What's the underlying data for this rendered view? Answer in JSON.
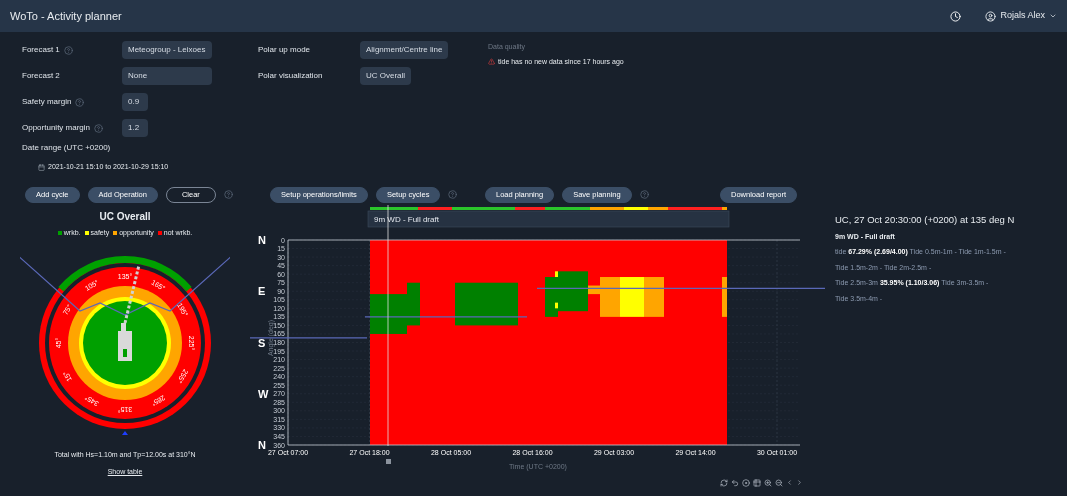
{
  "header": {
    "title": "WoTo - Activity planner",
    "user": "Rojals Alex"
  },
  "settings_left": [
    {
      "label": "Forecast 1",
      "help": true,
      "value": "Meteogroup - Leixoes"
    },
    {
      "label": "Forecast 2",
      "help": false,
      "value": "None"
    },
    {
      "label": "Safety margin",
      "help": true,
      "value": "0.9"
    },
    {
      "label": "Opportunity margin",
      "help": true,
      "value": "1.2"
    }
  ],
  "settings_mid": [
    {
      "label": "Polar up mode",
      "value": "Alignment/Centre line"
    },
    {
      "label": "Polar visualization",
      "value": "UC Overall"
    }
  ],
  "data_quality": {
    "title": "Data quality",
    "warning": "tide has no new data since 17 hours ago"
  },
  "date_range": {
    "label": "Date range (UTC +0200)",
    "value": "2021-10-21 15:10 to 2021-10-29 15:10"
  },
  "buttons_left": [
    {
      "label": "Add cycle",
      "kind": "filled"
    },
    {
      "label": "Add Operation",
      "kind": "filled"
    },
    {
      "label": "Clear",
      "kind": "outline"
    }
  ],
  "buttons_mid": [
    {
      "label": "Setup operations/limits",
      "kind": "filled"
    },
    {
      "label": "Setup cycles",
      "kind": "filled"
    }
  ],
  "buttons_plan": [
    {
      "label": "Load planning",
      "kind": "filled"
    },
    {
      "label": "Save planning",
      "kind": "filled"
    }
  ],
  "download": {
    "label": "Download report"
  },
  "polar": {
    "title": "UC Overall",
    "legend": [
      {
        "label": "wrkb.",
        "color": "#00a000"
      },
      {
        "label": "safety",
        "color": "#ffff00"
      },
      {
        "label": "opportunity",
        "color": "#ffa500"
      },
      {
        "label": "not wrkb.",
        "color": "#ff0000"
      }
    ],
    "angle_labels": [
      "135°",
      "165°",
      "195°",
      "225°",
      "255°",
      "285°",
      "315°",
      "345°",
      "15°",
      "45°",
      "75°",
      "105°"
    ],
    "caption": "Total with Hs=1.10m and Tp=12.00s at 310°N",
    "link": "Show table"
  },
  "chart": {
    "operation": "9m WD - Full draft",
    "compass": [
      "N",
      "E",
      "S",
      "W",
      "N"
    ],
    "y_ticks": [
      "0",
      "15",
      "30",
      "45",
      "60",
      "75",
      "90",
      "105",
      "120",
      "135",
      "150",
      "165",
      "180",
      "195",
      "210",
      "225",
      "240",
      "255",
      "270",
      "285",
      "300",
      "315",
      "330",
      "345",
      "360"
    ],
    "x_ticks": [
      "27 Oct 07:00",
      "27 Oct 18:00",
      "28 Oct 05:00",
      "28 Oct 16:00",
      "29 Oct 03:00",
      "29 Oct 14:00",
      "30 Oct 01:00"
    ],
    "xlabel": "Time (UTC +0200)",
    "ylabel": "Angle (deg)"
  },
  "details": {
    "title": "UC, 27 Oct 20:30:00 (+0200) at 135 deg N",
    "operation": "9m WD - Full draft",
    "lines": [
      "tide **67.29% (2.69/4.00)** Tide 0.5m-1m - Tide 1m-1.5m -",
      "Tide 1.5m-2m - Tide 2m-2.5m -",
      "Tide 2.5m-3m **35.95% (1.10/3.06)** Tide 3m-3.5m -",
      "Tide 3.5m-4m -"
    ]
  }
}
